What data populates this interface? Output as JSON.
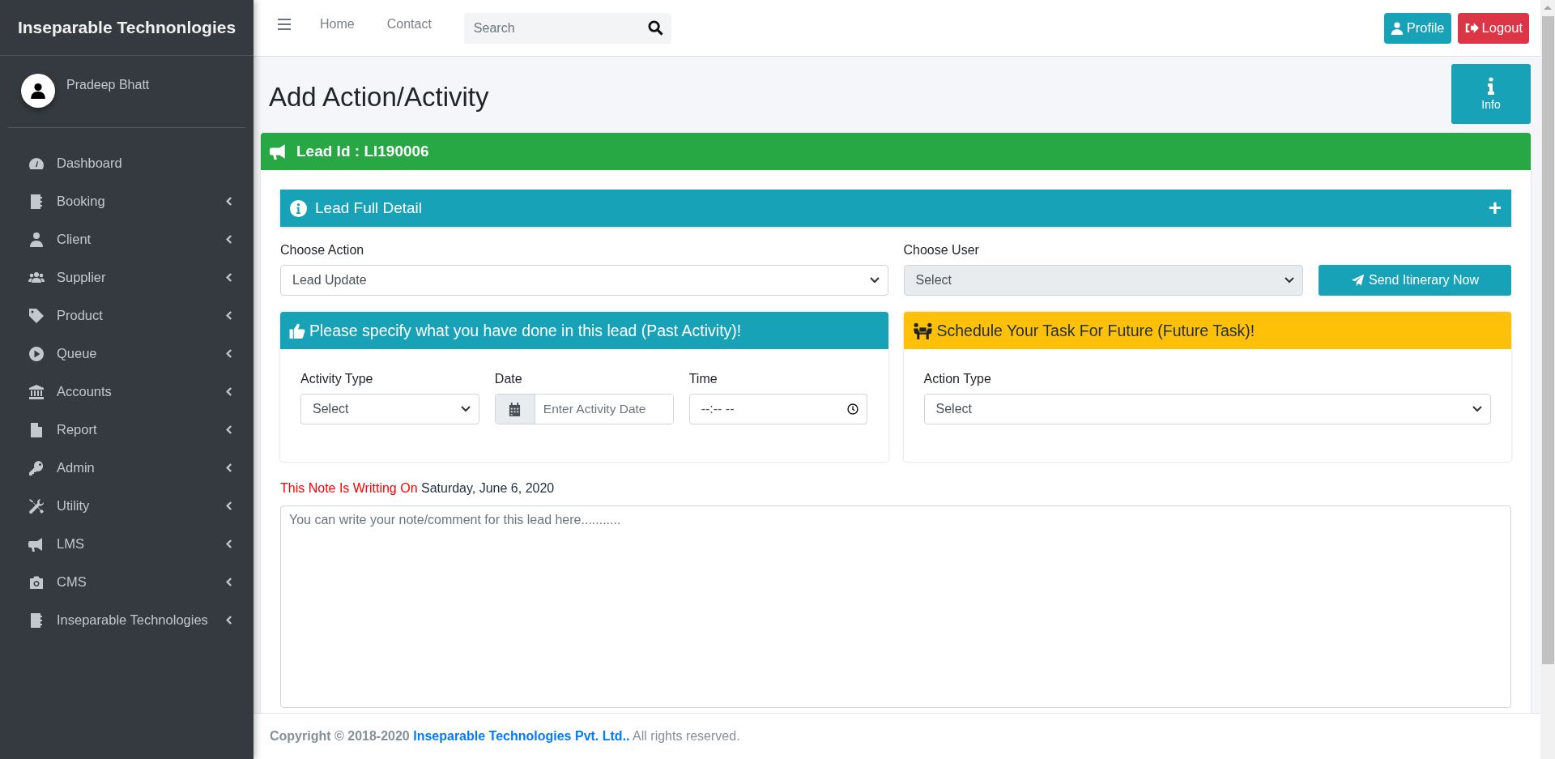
{
  "sidebar": {
    "brand": "Inseparable Technonlogies",
    "user": "Pradeep Bhatt",
    "items": [
      {
        "label": "Dashboard",
        "expandable": false
      },
      {
        "label": "Booking",
        "expandable": true
      },
      {
        "label": "Client",
        "expandable": true
      },
      {
        "label": "Supplier",
        "expandable": true
      },
      {
        "label": "Product",
        "expandable": true
      },
      {
        "label": "Queue",
        "expandable": true
      },
      {
        "label": "Accounts",
        "expandable": true
      },
      {
        "label": "Report",
        "expandable": true
      },
      {
        "label": "Admin",
        "expandable": true
      },
      {
        "label": "Utility",
        "expandable": true
      },
      {
        "label": "LMS",
        "expandable": true
      },
      {
        "label": "CMS",
        "expandable": true
      },
      {
        "label": "Inseparable Technologies",
        "expandable": true
      }
    ]
  },
  "topbar": {
    "links": [
      "Home",
      "Contact"
    ],
    "search": {
      "placeholder": "Search"
    },
    "profile": "Profile",
    "logout": "Logout"
  },
  "page_title": "Add Action/Activity",
  "info_button": "Info",
  "lead_card": {
    "title": "Lead Id : LI190006",
    "detail_bar": "Lead Full Detail",
    "detail_toggle": "+",
    "choose_action": {
      "label": "Choose Action",
      "value": "Lead Update"
    },
    "choose_user": {
      "label": "Choose User",
      "value": "Select",
      "disabled": true
    },
    "send_button": "Send Itinerary Now",
    "past_panel": {
      "title": "Please specify what you have done in this lead (Past Activity)!",
      "activity_type": {
        "label": "Activity Type",
        "value": "Select"
      },
      "date": {
        "label": "Date",
        "placeholder": "Enter Activity Date"
      },
      "time": {
        "label": "Time",
        "value": "--:-- --"
      }
    },
    "future_panel": {
      "title": "Schedule Your Task For Future (Future Task)!",
      "action_type": {
        "label": "Action Type",
        "value": "Select"
      }
    },
    "note": {
      "prefix": "This Note Is Writting On",
      "date": "Saturday, June 6, 2020",
      "placeholder": "You can write your note/comment for this lead here..........."
    }
  },
  "footer": {
    "copyright": "Copyright © 2018-2020",
    "company": "Inseparable Technologies Pvt. Ltd..",
    "rest": "All rights reserved."
  }
}
